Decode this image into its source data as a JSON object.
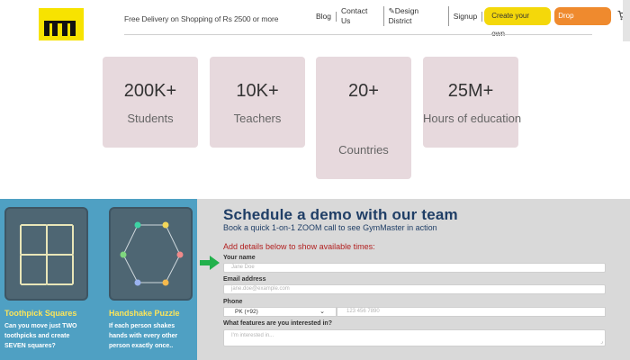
{
  "header": {
    "delivery_text": "Free Delivery on Shopping of Rs 2500 or more",
    "nav": [
      "Blog",
      "Contact Us",
      "Design District",
      "Signup"
    ],
    "create_label": "Create your own",
    "complaint_label": "Drop Complaint",
    "cart_count": "0"
  },
  "stats": [
    {
      "value": "200K+",
      "label": "Students"
    },
    {
      "value": "10K+",
      "label": "Teachers"
    },
    {
      "value": "20+",
      "label": "Countries"
    },
    {
      "value": "25M+",
      "label": "Hours of education"
    }
  ],
  "puzzles": [
    {
      "title": "Toothpick Squares",
      "text": [
        "Can you move just TWO",
        "toothpicks and create",
        "SEVEN squares?"
      ]
    },
    {
      "title": "Handshake Puzzle",
      "text": [
        "If each person shakes",
        "hands with every other",
        "person exactly once.."
      ]
    }
  ],
  "form": {
    "title": "Schedule a demo with our team",
    "subtitle": "Book a quick 1-on-1 ZOOM call to see GymMaster in action",
    "note": "Add details below to show available times:",
    "name_label": "Your name",
    "name_placeholder": "Jane Doe",
    "email_label": "Email address",
    "email_placeholder": "jane.doe@example.com",
    "phone_label": "Phone",
    "country_code": "PK (+92)",
    "phone_placeholder": "123 456 7890",
    "features_label": "What features are you interested in?",
    "features_placeholder": "I'm interested in..."
  },
  "colors": {
    "logo": "#f7e300",
    "stat_card": "#e7d9dd",
    "left_panel": "#4fa0c3",
    "form_title": "#1f3e66",
    "form_note": "#b22121",
    "create_button": "#f4d80a",
    "complaint_button": "#ef8a2e",
    "arrow": "#22b14c"
  }
}
